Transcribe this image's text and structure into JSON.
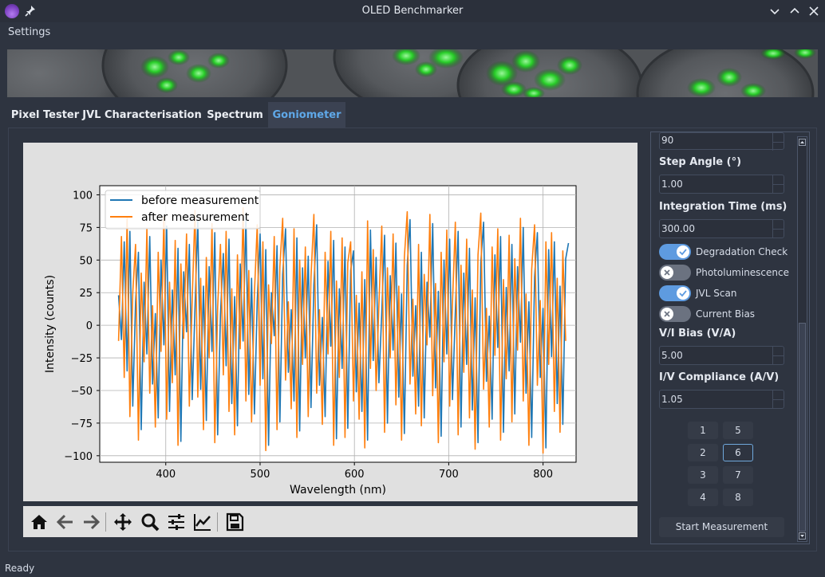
{
  "window": {
    "title": "OLED Benchmarker"
  },
  "menu": {
    "items": [
      "Settings"
    ]
  },
  "tabs": [
    {
      "label": "Pixel Tester",
      "active": false
    },
    {
      "label": "JVL Characterisation",
      "active": false
    },
    {
      "label": "Spectrum",
      "active": false
    },
    {
      "label": "Goniometer",
      "active": true
    }
  ],
  "settings": {
    "top_value": "90",
    "step_angle": {
      "label": "Step Angle (°)",
      "value": "1.00"
    },
    "integration_time": {
      "label": "Integration Time (ms)",
      "value": "300.00"
    },
    "toggles": [
      {
        "label": "Degradation Check",
        "on": true
      },
      {
        "label": "Photoluminescence",
        "on": false
      },
      {
        "label": "JVL Scan",
        "on": true
      },
      {
        "label": "Current Bias",
        "on": false
      }
    ],
    "bias": {
      "label": "V/I Bias (V/A)",
      "value": "5.00"
    },
    "compliance": {
      "label": "I/V Compliance (A/V)",
      "value": "1.05"
    },
    "pixels": [
      {
        "label": "1",
        "selected": false
      },
      {
        "label": "5",
        "selected": false
      },
      {
        "label": "2",
        "selected": false
      },
      {
        "label": "6",
        "selected": true
      },
      {
        "label": "3",
        "selected": false
      },
      {
        "label": "7",
        "selected": false
      },
      {
        "label": "4",
        "selected": false
      },
      {
        "label": "8",
        "selected": false
      }
    ],
    "start_button": "Start Measurement"
  },
  "toolbar": {
    "buttons": [
      "home-icon",
      "back-arrow-icon",
      "forward-arrow-icon",
      "pan-icon",
      "zoom-icon",
      "configure-subplots-icon",
      "edit-axes-icon",
      "save-icon"
    ]
  },
  "status": {
    "text": "Ready"
  },
  "colors": {
    "accent": "#5fa8e8",
    "series_before": "#1f77b4",
    "series_after": "#ff7f0e"
  },
  "chart_data": {
    "type": "line",
    "title": "",
    "xlabel": "Wavelength (nm)",
    "ylabel": "Intensity (counts)",
    "xlim": [
      330,
      835
    ],
    "ylim": [
      -105,
      107
    ],
    "xticks": [
      400,
      500,
      600,
      700,
      800
    ],
    "yticks": [
      -100,
      -75,
      -50,
      -25,
      0,
      25,
      50,
      75,
      100
    ],
    "grid": true,
    "legend": "top-left",
    "x": [
      350,
      353,
      356,
      359,
      362,
      365,
      368,
      371,
      374,
      377,
      380,
      383,
      386,
      389,
      392,
      395,
      398,
      401,
      404,
      407,
      410,
      413,
      416,
      419,
      422,
      425,
      428,
      431,
      434,
      437,
      440,
      443,
      446,
      449,
      452,
      455,
      458,
      461,
      464,
      467,
      470,
      473,
      476,
      479,
      482,
      485,
      488,
      491,
      494,
      497,
      500,
      503,
      506,
      509,
      512,
      515,
      518,
      521,
      524,
      527,
      530,
      533,
      536,
      539,
      542,
      545,
      548,
      551,
      554,
      557,
      560,
      563,
      566,
      569,
      572,
      575,
      578,
      581,
      584,
      587,
      590,
      593,
      596,
      599,
      602,
      605,
      608,
      611,
      614,
      617,
      620,
      623,
      626,
      629,
      632,
      635,
      638,
      641,
      644,
      647,
      650,
      653,
      656,
      659,
      662,
      665,
      668,
      671,
      674,
      677,
      680,
      683,
      686,
      689,
      692,
      695,
      698,
      701,
      704,
      707,
      710,
      713,
      716,
      719,
      722,
      725,
      728,
      731,
      734,
      737,
      740,
      743,
      746,
      749,
      752,
      755,
      758,
      761,
      764,
      767,
      770,
      773,
      776,
      779,
      782,
      785,
      788,
      791,
      794,
      797,
      800,
      803,
      806,
      809,
      812,
      815,
      818,
      821,
      824,
      827
    ],
    "series": [
      {
        "name": "before measurement",
        "values": [
          23,
          -11,
          64,
          -35,
          72,
          -62,
          18,
          56,
          -80,
          33,
          -22,
          68,
          -45,
          9,
          -71,
          50,
          -15,
          76,
          -66,
          27,
          -38,
          59,
          -89,
          41,
          -5,
          62,
          -57,
          14,
          80,
          -49,
          30,
          -73,
          45,
          -20,
          71,
          -84,
          8,
          55,
          -31,
          66,
          -60,
          22,
          -77,
          47,
          -12,
          83,
          -53,
          36,
          -68,
          19,
          70,
          -41,
          58,
          -92,
          25,
          -8,
          61,
          -74,
          39,
          74,
          -36,
          12,
          -58,
          67,
          -81,
          44,
          -25,
          53,
          -63,
          31,
          77,
          -46,
          6,
          -70,
          49,
          -16,
          65,
          -87,
          28,
          -33,
          60,
          -79,
          42,
          57,
          -51,
          17,
          -66,
          35,
          -88,
          73,
          -27,
          52,
          -44,
          10,
          69,
          -75,
          38,
          -19,
          63,
          -55,
          24,
          -83,
          46,
          81,
          -39,
          15,
          -62,
          56,
          -71,
          33,
          -9,
          78,
          -48,
          26,
          -85,
          50,
          -22,
          66,
          -57,
          11,
          72,
          -78,
          40,
          -30,
          59,
          -65,
          21,
          -90,
          48,
          79,
          -43,
          7,
          -72,
          54,
          -17,
          68,
          -82,
          29,
          -35,
          62,
          -68,
          45,
          -13,
          75,
          -52,
          18,
          -86,
          37,
          71,
          -40,
          13,
          -94,
          58,
          -24,
          64,
          -60,
          30,
          -76,
          51,
          63
        ]
      },
      {
        "name": "after measurement",
        "values": [
          -12,
          68,
          -40,
          82,
          -70,
          25,
          62,
          -88,
          40,
          -28,
          74,
          -52,
          15,
          -78,
          56,
          -20,
          83,
          -72,
          33,
          -44,
          65,
          -92,
          47,
          -10,
          70,
          -62,
          20,
          88,
          -55,
          36,
          -80,
          52,
          -25,
          78,
          -90,
          14,
          62,
          -38,
          72,
          -66,
          28,
          -84,
          54,
          -18,
          90,
          -58,
          42,
          -74,
          25,
          77,
          -46,
          64,
          -96,
          31,
          -14,
          68,
          -80,
          45,
          82,
          -42,
          18,
          -64,
          74,
          -86,
          50,
          -30,
          60,
          -70,
          37,
          85,
          -52,
          12,
          -76,
          56,
          -22,
          72,
          -92,
          34,
          -40,
          67,
          -86,
          48,
          64,
          -58,
          23,
          -72,
          41,
          -94,
          80,
          -33,
          58,
          -50,
          16,
          76,
          -82,
          44,
          -25,
          70,
          -61,
          30,
          -88,
          52,
          87,
          -45,
          20,
          -68,
          62,
          -77,
          39,
          -15,
          85,
          -54,
          32,
          -90,
          56,
          -28,
          73,
          -62,
          17,
          79,
          -84,
          46,
          -36,
          66,
          -71,
          27,
          -95,
          54,
          86,
          -49,
          13,
          -78,
          60,
          -23,
          74,
          -88,
          35,
          -41,
          69,
          -74,
          51,
          -19,
          82,
          -58,
          24,
          -92,
          43,
          77,
          -46,
          19,
          -98,
          64,
          -30,
          71,
          -66,
          36,
          -82,
          57,
          -12
        ]
      }
    ]
  }
}
